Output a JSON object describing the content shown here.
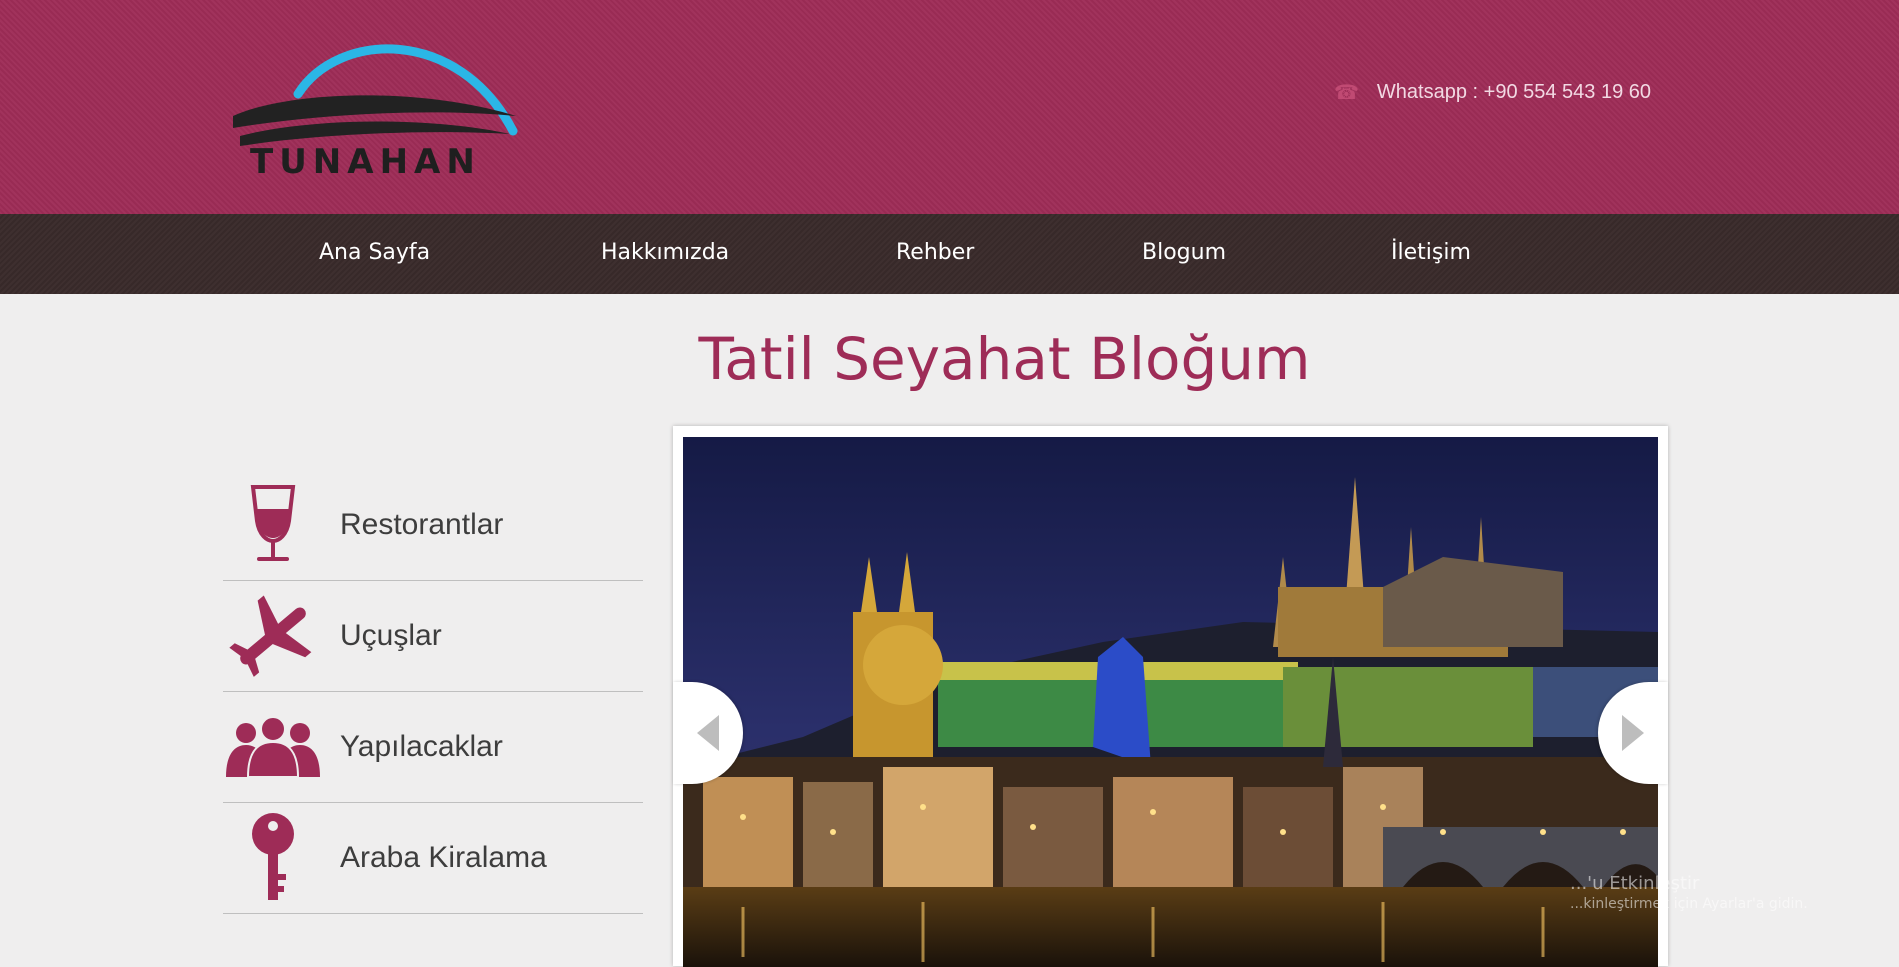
{
  "header": {
    "logo_text": "TUNAHAN",
    "phone_icon": "phone-icon",
    "contact_text": "Whatsapp : +90 554 543 19 60"
  },
  "nav": {
    "items": [
      "Ana Sayfa",
      "Hakkımızda",
      "Rehber",
      "Blogum",
      "İletişim"
    ]
  },
  "main": {
    "title": "Tatil Seyahat Bloğum"
  },
  "sidebar": {
    "items": [
      {
        "label": "Restorantlar",
        "icon": "wine-glass-icon"
      },
      {
        "label": "Uçuşlar",
        "icon": "airplane-icon"
      },
      {
        "label": "Yapılacaklar",
        "icon": "people-icon"
      },
      {
        "label": "Araba Kiralama",
        "icon": "key-icon"
      }
    ]
  },
  "slider": {
    "image": "prague-castle-night-photo",
    "prev_icon": "chevron-left-icon",
    "next_icon": "chevron-right-icon"
  },
  "watermark": {
    "line1": "...'u Etkinleştir",
    "line2": "...kinleştirmek için Ayarlar'a gidin."
  },
  "colors": {
    "brand": "#9e2c57",
    "nav_bg": "#3a2b2b",
    "page_bg": "#efeeee",
    "logo_arc": "#2bb6e6"
  }
}
